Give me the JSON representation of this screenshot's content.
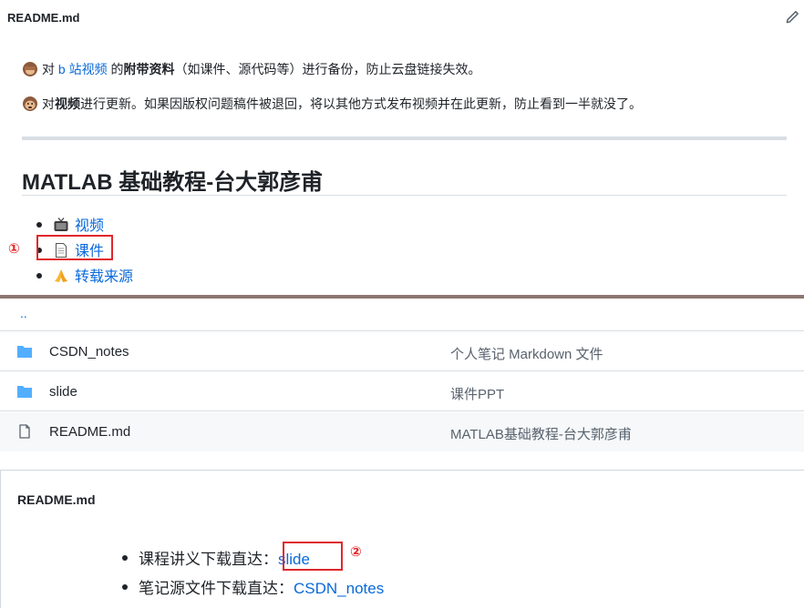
{
  "header": {
    "filename": "README.md",
    "edit_icon": "pencil-icon"
  },
  "intro": {
    "line1": {
      "emoji": "see-no-evil-monkey-icon",
      "prefix": "对 ",
      "link": "b 站视频",
      "middle": " 的",
      "bold": "附带资料",
      "suffix": "（如课件、源代码等）进行备份，防止云盘链接失效。"
    },
    "line2": {
      "emoji": "monkey-face-icon",
      "prefix": "对",
      "bold": "视频",
      "suffix": "进行更新。如果因版权问题稿件被退回，将以其他方式发布视频并在此更新，防止看到一半就没了。"
    }
  },
  "heading": "MATLAB 基础教程-台大郭彦甫",
  "links": [
    {
      "emoji": "tv-icon",
      "label": "视频"
    },
    {
      "emoji": "page-icon",
      "label": "课件"
    },
    {
      "emoji": "folded-hands-icon",
      "label": "转载来源"
    }
  ],
  "annotations": {
    "one": "①",
    "two": "②"
  },
  "file_list": {
    "parent": "..",
    "rows": [
      {
        "icon": "folder-icon",
        "name": "CSDN_notes",
        "description": "个人笔记 Markdown 文件"
      },
      {
        "icon": "folder-icon",
        "name": "slide",
        "description": "课件PPT"
      },
      {
        "icon": "file-icon",
        "name": "README.md",
        "description": "MATLAB基础教程-台大郭彦甫"
      }
    ]
  },
  "readme": {
    "title": "README.md",
    "items": [
      {
        "label": "课程讲义下载直达：",
        "link": "slide"
      },
      {
        "label": "笔记源文件下载直达：",
        "link": "CSDN_notes"
      }
    ]
  },
  "colors": {
    "link": "#0969da",
    "annotation": "#e0272b",
    "folder": "#54aeff",
    "divider": "#8c7770"
  }
}
